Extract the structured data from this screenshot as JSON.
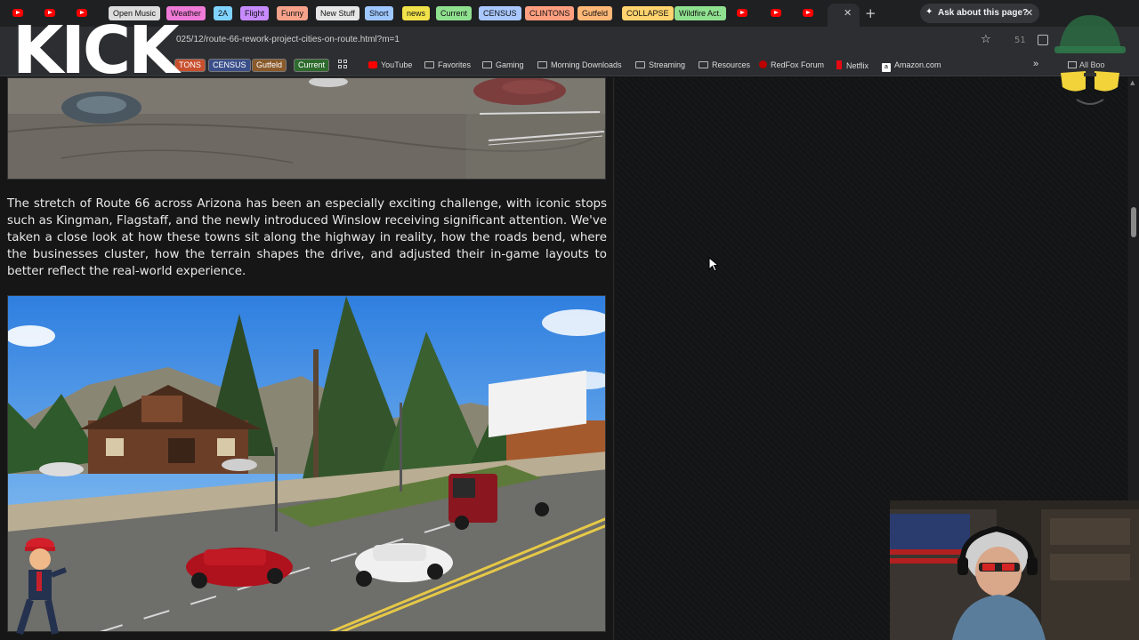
{
  "tabs": {
    "pills": [
      {
        "label": "Open Music",
        "color": "#dcdcdc"
      },
      {
        "label": "Weather",
        "color": "#f07ad8"
      },
      {
        "label": "2A",
        "color": "#7fd3ff"
      },
      {
        "label": "Flight",
        "color": "#c78bff"
      },
      {
        "label": "Funny",
        "color": "#f6a28b"
      },
      {
        "label": "New Stuff",
        "color": "#e6e6e6"
      },
      {
        "label": "Short",
        "color": "#9ec7ff"
      },
      {
        "label": "news",
        "color": "#f2e24a"
      },
      {
        "label": "Current",
        "color": "#8fe08f"
      },
      {
        "label": "CENSUS",
        "color": "#a9c8ff"
      },
      {
        "label": "CLINTONS",
        "color": "#ff9f80"
      },
      {
        "label": "Gutfeld",
        "color": "#ffb877"
      },
      {
        "label": "COLLAPSE",
        "color": "#ffd36e"
      },
      {
        "label": "Wildfire Act.",
        "color": "#8fe08f"
      }
    ],
    "ask_label": "Ask about this page?"
  },
  "address_bar": {
    "url": "025/12/route-66-rework-project-cities-on-route.html?m=1",
    "count": "51"
  },
  "bookmarks": {
    "pills": [
      {
        "label": "TONS",
        "color": "#c8502e"
      },
      {
        "label": "CENSUS",
        "color": "#3a4f8a"
      },
      {
        "label": "Gutfeld",
        "color": "#8a5a2b"
      },
      {
        "label": "Current",
        "color": "#2e6b2e"
      }
    ],
    "items": [
      {
        "label": "YouTube",
        "icon": "youtube-icon"
      },
      {
        "label": "Favorites",
        "icon": "folder-icon"
      },
      {
        "label": "Gaming",
        "icon": "folder-icon"
      },
      {
        "label": "Morning Downloads",
        "icon": "folder-icon"
      },
      {
        "label": "Streaming",
        "icon": "folder-icon"
      },
      {
        "label": "Resources",
        "icon": "folder-icon"
      },
      {
        "label": "RedFox Forum",
        "icon": "redfox-icon"
      },
      {
        "label": "Netflix",
        "icon": "netflix-icon"
      },
      {
        "label": "Amazon.com",
        "icon": "amazon-icon"
      }
    ],
    "all_bookmarks": "All Boo"
  },
  "overlay": {
    "kick_logo": "KICK"
  },
  "article": {
    "paragraph": "The stretch of Route 66 across Arizona has been an especially exciting challenge, with iconic stops such as Kingman, Flagstaff, and the newly introduced Winslow receiving significant attention. We've taken a close look at how these towns sit along the highway in reality, how the roads bend, where the businesses cluster, how the terrain shapes the drive, and adjusted their in-game layouts to better reflect the real-world experience."
  }
}
